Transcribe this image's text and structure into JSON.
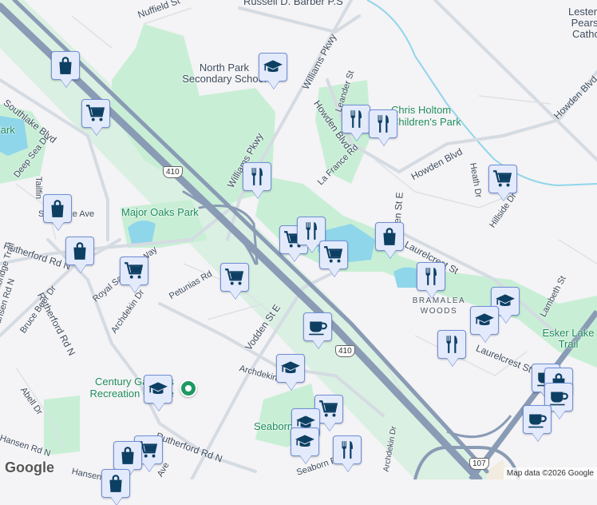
{
  "map": {
    "highway_shields": [
      "410",
      "410",
      "107"
    ],
    "streets": [
      "Nuffield St",
      "Williams Pkwy",
      "Williams Pkwy",
      "Leander St",
      "Howden Blvd",
      "Howden Blvd",
      "Howden Blvd",
      "La France Rd",
      "Vodden St E",
      "Vodden St E",
      "Heath Dr",
      "Hillside Dr",
      "Laurelcrest St",
      "Laurelcrest St",
      "Lambeth St",
      "Southlake Blvd",
      "Deep Sea Dr",
      "Tailfin",
      "Southlake Ave",
      "Rutherford Rd N",
      "Rutherford Rd N",
      "Rutherford Rd N",
      "Royal Salisbury Way",
      "Petunias Rd",
      "Archdekin Dr",
      "Archdekin Dr",
      "Archdekin Dr",
      "Bruce Beer Dr",
      "Hansen Rd N",
      "Hansen Rd N",
      "Abell Dr",
      "Trailbridge Trail",
      "Seaborn Rd",
      "Hansen",
      "Ave"
    ],
    "places": {
      "school_top": "Russell D. Barber P.S",
      "north_park": "North Park Secondary School",
      "major_oaks": "Major Oaks Park",
      "holtom": "Chris Holtom Children's Park",
      "century": "Century Gardens Recreation Centre",
      "seaborn": "Seaborn Park",
      "esker": "Esker Lake Trail",
      "pearson": "Lester B. Pearson Catholic",
      "bramalea": "BRAMALEA WOODS",
      "lake_park": "Park"
    },
    "markers": [
      "shopping",
      "shopping-cart",
      "school",
      "restaurant",
      "shopping",
      "shopping",
      "shopping-cart",
      "shopping-cart",
      "restaurant",
      "shopping-cart",
      "restaurant",
      "restaurant",
      "shopping-cart",
      "shopping",
      "restaurant",
      "school",
      "school",
      "shopping-cart",
      "coffee",
      "restaurant",
      "school",
      "school",
      "shopping-cart",
      "school",
      "school",
      "restaurant",
      "shopping-cart",
      "shopping",
      "shopping",
      "coffee",
      "shopping",
      "coffee",
      "coffee",
      "place-pin"
    ],
    "logo": "Google",
    "attribution": "Map data ©2026 Google",
    "colors": {
      "background": "#f4f3f5",
      "park": "#c8efd6",
      "water": "#8fd6ea",
      "highway": "#8a9bb5",
      "road": "#d5dbe2",
      "marker_fill": "#e3eafb",
      "marker_icon": "#0d3f63"
    }
  }
}
